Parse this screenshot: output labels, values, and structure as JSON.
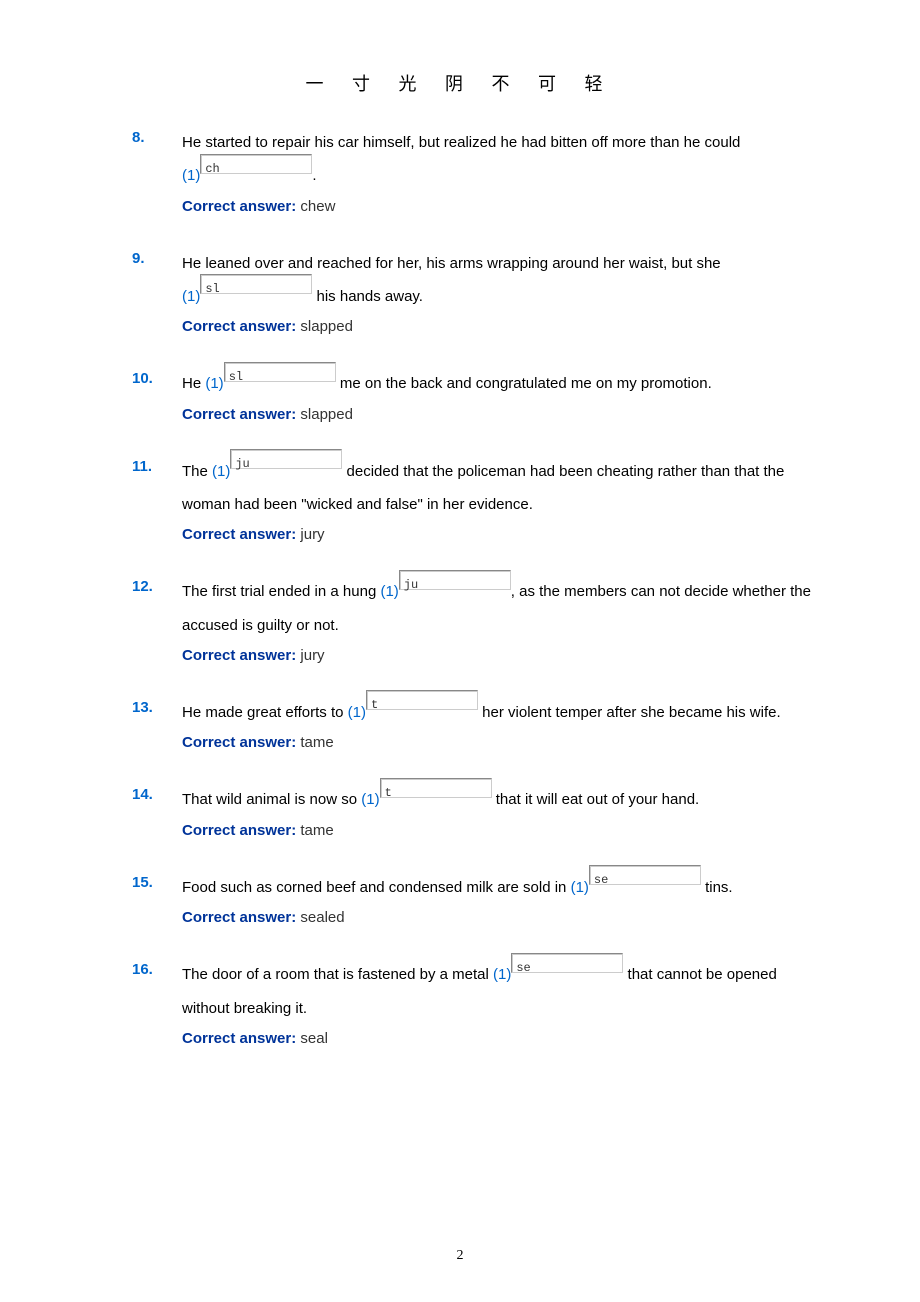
{
  "header_idiom": "一 寸 光 阴 不 可 轻",
  "answer_label": "Correct answer:",
  "page_number": "2",
  "questions": [
    {
      "num": "8.",
      "parts": [
        {
          "text": "He started to repair his car himself, but realized he had bitten off more than he could "
        },
        {
          "blank": {
            "marker": "(1)",
            "value": "ch"
          }
        },
        {
          "text": "."
        }
      ],
      "break_after": 0,
      "answer": "chew"
    },
    {
      "num": "9.",
      "parts": [
        {
          "text": "He leaned over and reached for her, his arms wrapping around her waist, but she "
        },
        {
          "blank": {
            "marker": "(1)",
            "value": "sl"
          }
        },
        {
          "text": " his hands away."
        }
      ],
      "break_after": 0,
      "answer": "slapped"
    },
    {
      "num": "10.",
      "parts": [
        {
          "text": "He "
        },
        {
          "blank": {
            "marker": "(1)",
            "value": "sl"
          }
        },
        {
          "text": " me on the back and congratulated me on my promotion."
        }
      ],
      "answer": "slapped"
    },
    {
      "num": "11.",
      "parts": [
        {
          "text": "The "
        },
        {
          "blank": {
            "marker": "(1)",
            "value": "ju"
          }
        },
        {
          "text": " decided that the policeman had been cheating rather than that the woman had been \"wicked and false\" in her evidence."
        }
      ],
      "answer": "jury"
    },
    {
      "num": "12.",
      "parts": [
        {
          "text": "The first trial ended in a hung "
        },
        {
          "blank": {
            "marker": "(1)",
            "value": "ju"
          }
        },
        {
          "text": ", as the members can not decide whether the accused is guilty or not."
        }
      ],
      "answer": "jury"
    },
    {
      "num": "13.",
      "parts": [
        {
          "text": "He made great efforts to "
        },
        {
          "blank": {
            "marker": "(1)",
            "value": "t"
          }
        },
        {
          "text": " her violent temper after she became his wife."
        }
      ],
      "answer": "tame"
    },
    {
      "num": "14.",
      "parts": [
        {
          "text": "That wild animal is now so "
        },
        {
          "blank": {
            "marker": "(1)",
            "value": "t"
          }
        },
        {
          "text": " that it will eat out of your hand."
        }
      ],
      "answer": "tame"
    },
    {
      "num": "15.",
      "parts": [
        {
          "text": "Food such as corned beef and condensed milk are sold in "
        },
        {
          "blank": {
            "marker": "(1)",
            "value": "se"
          }
        },
        {
          "text": " tins."
        }
      ],
      "answer": "sealed"
    },
    {
      "num": "16.",
      "parts": [
        {
          "text": "The door of a room that is fastened by a metal "
        },
        {
          "blank": {
            "marker": "(1)",
            "value": "se"
          }
        },
        {
          "text": " that cannot be opened without breaking it."
        }
      ],
      "answer": "seal"
    }
  ]
}
